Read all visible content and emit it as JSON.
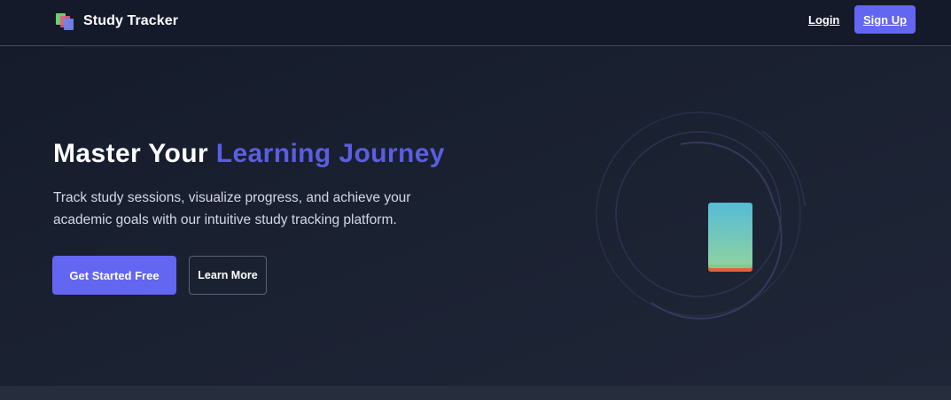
{
  "brand": {
    "name": "Study Tracker",
    "logo_icon": "book-stack-icon"
  },
  "nav": {
    "login_label": "Login",
    "signup_label": "Sign Up"
  },
  "hero": {
    "title_plain": "Master Your ",
    "title_accent": "Learning Journey",
    "subtitle": "Track study sessions, visualize progress, and achieve your academic goals with our intuitive study tracking platform.",
    "primary_button": "Get Started Free",
    "secondary_button": "Learn More",
    "illustration_icon": "book-icon"
  },
  "colors": {
    "accent": "#6366f1",
    "title_accent": "#5b5ee0",
    "background": "#1e2433",
    "navbar": "#141a2a"
  }
}
